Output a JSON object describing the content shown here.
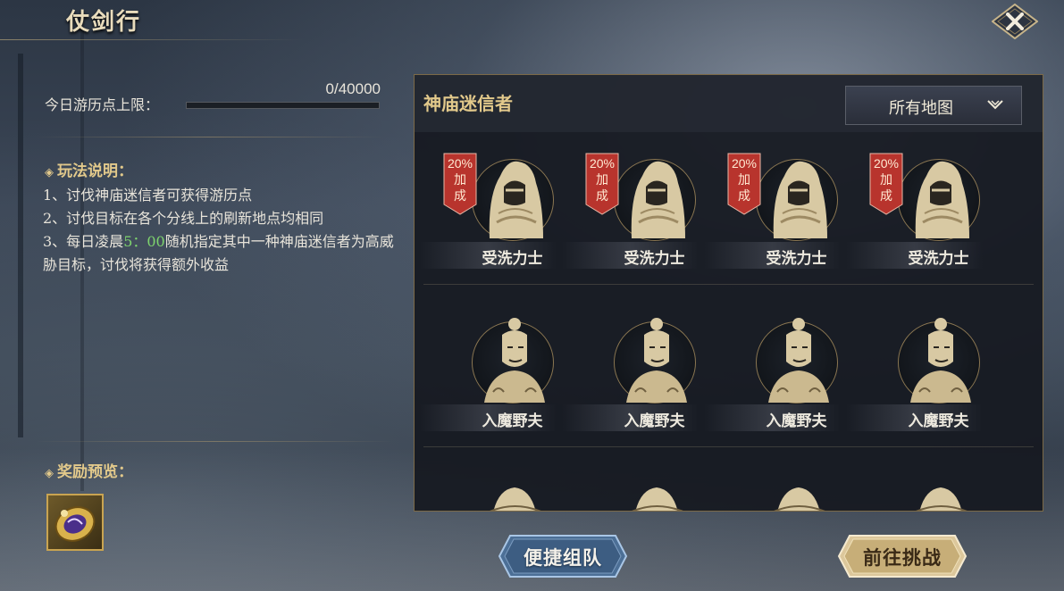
{
  "header": {
    "title": "仗剑行"
  },
  "left": {
    "limit_label": "今日游历点上限：",
    "limit_value": "0/40000",
    "limit_progress": 0,
    "rules_title": "玩法说明：",
    "rules": {
      "line1": "1、讨伐神庙迷信者可获得游历点",
      "line2": "2、讨伐目标在各个分线上的刷新地点均相同",
      "line3_prefix": "3、每日凌晨",
      "line3_time": "5：00",
      "line3_suffix": "随机指定其中一种神庙迷信者为高威胁目标，讨伐将获得额外收益"
    },
    "reward_title": "奖励预览："
  },
  "panel": {
    "title": "神庙迷信者",
    "map_select": "所有地图",
    "bonus_badge": {
      "percent": "20%",
      "line1": "加",
      "line2": "成"
    },
    "row1": [
      {
        "name": "受洗力士",
        "bonus": true
      },
      {
        "name": "受洗力士",
        "bonus": true
      },
      {
        "name": "受洗力士",
        "bonus": true
      },
      {
        "name": "受洗力士",
        "bonus": true
      }
    ],
    "row2": [
      {
        "name": "入魔野夫",
        "bonus": false
      },
      {
        "name": "入魔野夫",
        "bonus": false
      },
      {
        "name": "入魔野夫",
        "bonus": false
      },
      {
        "name": "入魔野夫",
        "bonus": false
      }
    ]
  },
  "buttons": {
    "team": "便捷组队",
    "challenge": "前往挑战"
  },
  "colors": {
    "gold": "#e2c98b",
    "badge_red": "#b8342d",
    "green": "#7ed46e"
  },
  "icons": {
    "close": "close-x-icon",
    "dropdown": "chevron-down-icon",
    "reward": "jade-token-icon"
  }
}
